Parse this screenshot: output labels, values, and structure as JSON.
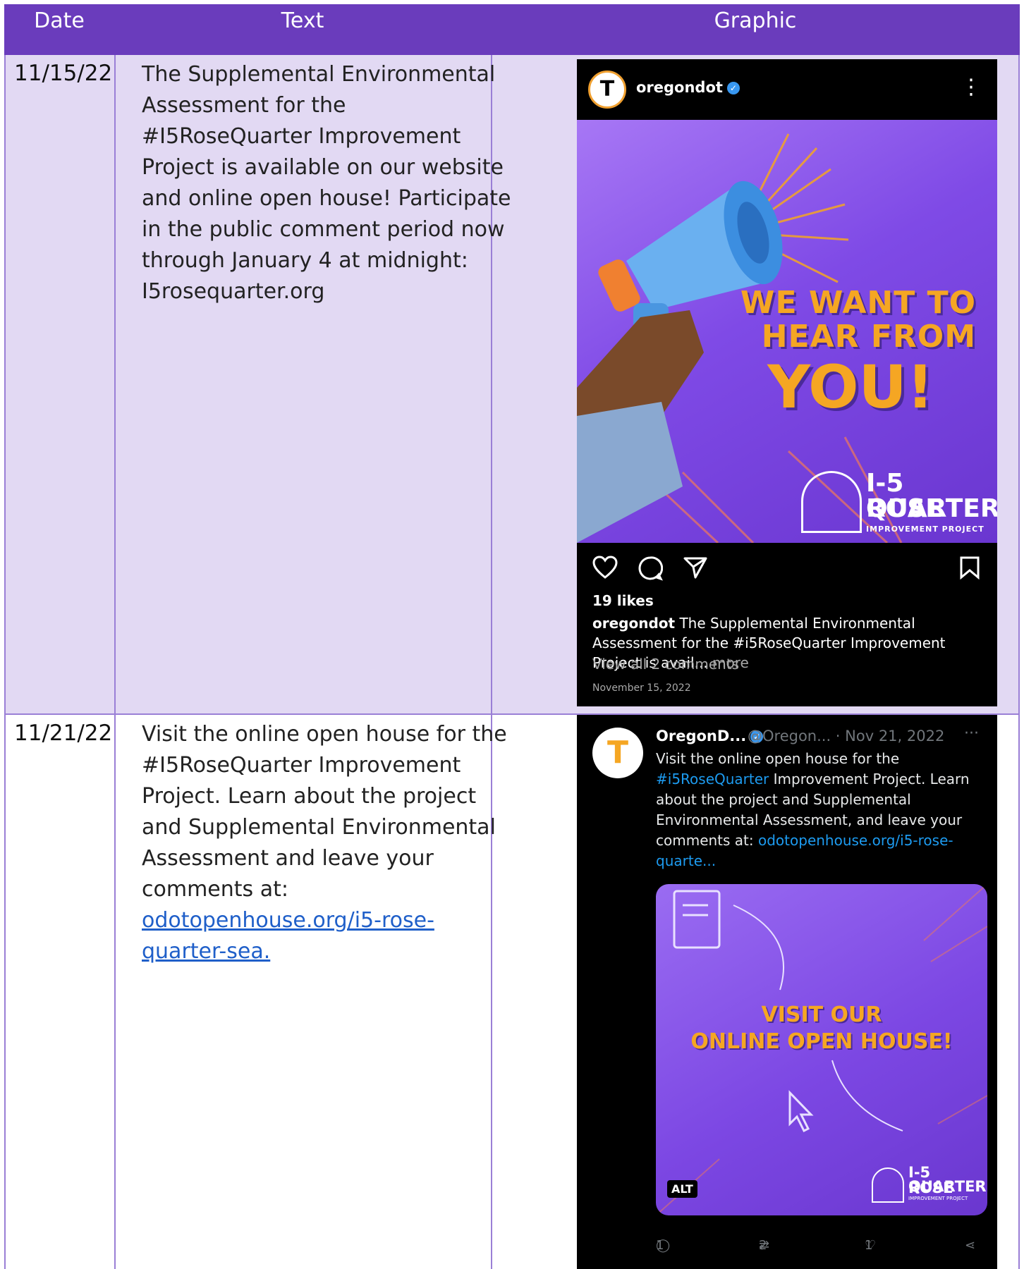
{
  "header": {
    "date": "Date",
    "text": "Text",
    "graphic": "Graphic"
  },
  "rows": [
    {
      "date": "11/15/22",
      "text": "The Supplemental Environmental Assessment for the #I5RoseQuarter Improvement Project is available on our website and online open house! Participate in the public comment period now through January 4 at midnight: I5rosequarter.org",
      "graphic": {
        "username": "oregondot",
        "headline_1": "WE WANT TO",
        "headline_2": "HEAR FROM",
        "headline_3": "YOU!",
        "logo_1": "I-5 ROSE",
        "logo_2": "QUARTER",
        "logo_3": "IMPROVEMENT PROJECT",
        "likes": "19 likes",
        "caption_user": "oregondot",
        "caption": " The Supplemental Environmental Assessment for the #i5RoseQuarter Improvement Project is avail...",
        "more": " more",
        "comments": "View all 2 comments",
        "date": "November 15, 2022"
      }
    },
    {
      "date": "11/21/22",
      "text": "Visit the online open house for the #I5RoseQuarter Improvement Project. Learn about the project and Supplemental Environmental Assessment and leave your comments at: ",
      "link": "odotopenhouse.org/i5-rose-quarter-sea.",
      "graphic": {
        "name": "OregonD...",
        "handle": "@Oregon... · Nov 21, 2022",
        "text_1": "Visit the online open house for the ",
        "hashtag": "#i5RoseQuarter",
        "text_2": " Improvement Project. Learn about the project and Supplemental Environmental Assessment, and leave your comments at: ",
        "link": "odotopenhouse.org/i5-rose-quarte...",
        "visit_1": "VISIT OUR",
        "visit_2": "ONLINE OPEN HOUSE!",
        "alt": "ALT",
        "logo_1": "I-5 ROSE",
        "logo_2": "QUARTER",
        "logo_3": "IMPROVEMENT PROJECT",
        "replies": "1",
        "retweets": "2",
        "likes": "1"
      }
    }
  ],
  "colors": {
    "header": "#6a3cbc",
    "row_highlight": "#e2d9f3",
    "accent_orange": "#f5a623"
  }
}
